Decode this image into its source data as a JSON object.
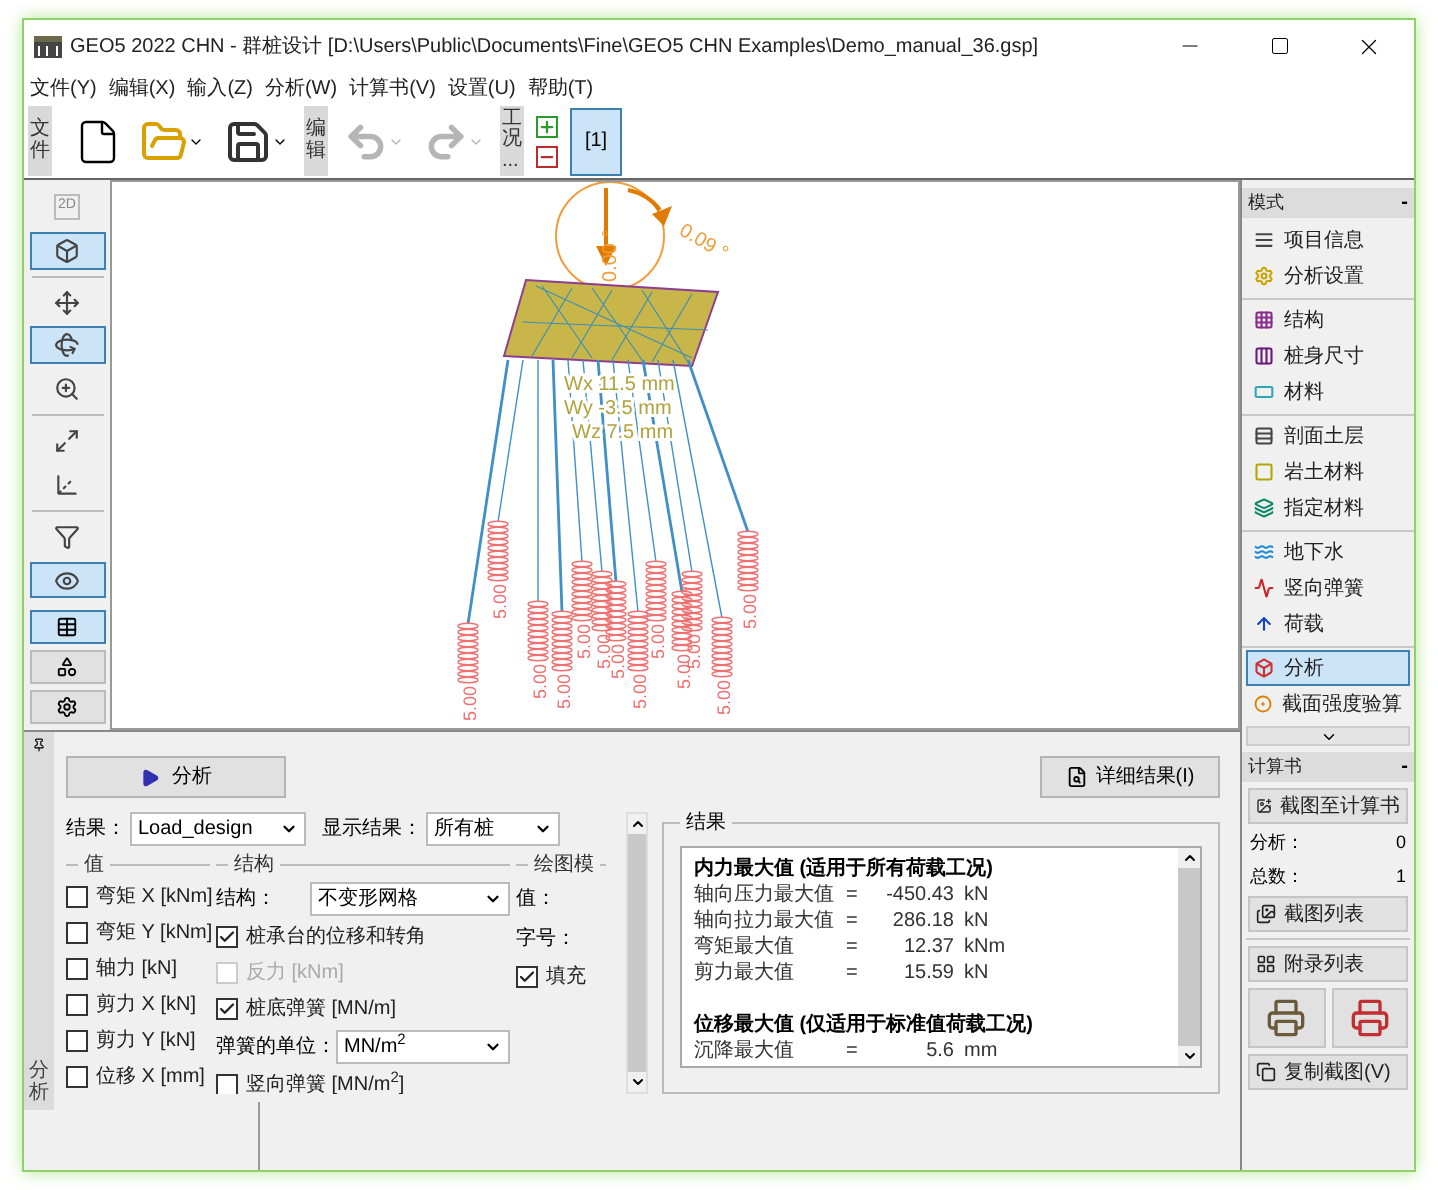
{
  "window": {
    "title": "GEO5 2022 CHN - 群桩设计 [D:\\Users\\Public\\Documents\\Fine\\GEO5 CHN Examples\\Demo_manual_36.gsp]"
  },
  "menu": [
    "文件(Y)",
    "编辑(X)",
    "输入(Z)",
    "分析(W)",
    "计算书(V)",
    "设置(U)",
    "帮助(T)"
  ],
  "toolbar": {
    "file_label": "文件",
    "edit_label": "编辑",
    "stage_label": "工况...",
    "undo": {
      "disabled": true
    },
    "redo": {
      "disabled": true
    },
    "stages": [
      {
        "label": "[1]",
        "selected": true
      }
    ]
  },
  "left_tools": [
    {
      "kind": "flat",
      "label": "2D",
      "selected": false
    },
    {
      "kind": "cube",
      "selected": true
    },
    {
      "kind": "pan",
      "selected": false
    },
    {
      "kind": "rotate",
      "selected": true
    },
    {
      "kind": "zoom",
      "selected": false
    },
    {
      "kind": "fit",
      "selected": false
    },
    {
      "kind": "axes",
      "selected": false
    },
    {
      "kind": "filter",
      "selected": false
    },
    {
      "kind": "eye",
      "selected": true
    }
  ],
  "bottom_tools": [
    {
      "kind": "table",
      "selected": true
    },
    {
      "kind": "shapes",
      "selected": false
    },
    {
      "kind": "gear",
      "selected": false
    }
  ],
  "viewport": {
    "angle_labels": [
      "0.09 °",
      "0.00 °"
    ],
    "displacements": [
      "Wx 11.5 mm",
      "Wy -3.5 mm",
      "Wz 7.5 mm"
    ],
    "spring_labels": [
      "5.00",
      "5.00",
      "5.00",
      "5.00",
      "5.00",
      "5.00",
      "5.00",
      "5.00",
      "5.00",
      "5.00",
      "5.00",
      "5.00",
      "5.00"
    ]
  },
  "analysis_panel": {
    "tab_label": "分析",
    "run_button": "分析",
    "detail_button": "详细结果(I)",
    "result_label": "结果：",
    "result_value": "Load_design",
    "show_label": "显示结果：",
    "show_value": "所有桩",
    "values_group": {
      "title": "值",
      "items": [
        {
          "label": "弯矩 X [kNm]",
          "checked": false
        },
        {
          "label": "弯矩 Y [kNm]",
          "checked": false
        },
        {
          "label": "轴力 [kN]",
          "checked": false
        },
        {
          "label": "剪力 X [kN]",
          "checked": false
        },
        {
          "label": "剪力 Y [kN]",
          "checked": false
        },
        {
          "label": "位移 X [mm]",
          "checked": false
        }
      ]
    },
    "structure_group": {
      "title": "结构",
      "structure_label": "结构：",
      "structure_value": "不变形网格",
      "options": [
        {
          "label": "桩承台的位移和转角",
          "checked": true,
          "disabled": false
        },
        {
          "label": "反力 [kNm]",
          "checked": false,
          "disabled": true
        },
        {
          "label": "桩底弹簧 [MN/m]",
          "checked": true,
          "disabled": false
        }
      ],
      "unit_label": "弹簧的单位：",
      "unit_value": "MN/m$^{2}$",
      "more_options": [
        {
          "label": "竖向弹簧 [MN/m$^{2}$]",
          "checked": false,
          "disabled": false
        }
      ]
    },
    "drawing_group": {
      "title": "绘图模",
      "value_label": "值：",
      "size_label": "字号：",
      "fill": {
        "label": "填充",
        "checked": true
      }
    },
    "results": {
      "title": "结果",
      "lines": [
        {
          "kind": "heading",
          "text": "内力最大值 (适用于所有荷载工况)"
        },
        {
          "kind": "row",
          "label": "轴向压力最大值",
          "sign": "=",
          "value": "-450.43",
          "unit": "kN"
        },
        {
          "kind": "row",
          "label": "轴向拉力最大值",
          "sign": "=",
          "value": "286.18",
          "unit": "kN"
        },
        {
          "kind": "row",
          "label": "弯矩最大值",
          "sign": "=",
          "value": "12.37",
          "unit": "kNm"
        },
        {
          "kind": "row",
          "label": "剪力最大值",
          "sign": "=",
          "value": "15.59",
          "unit": "kN"
        },
        {
          "kind": "heading",
          "text": "位移最大值 (仅适用于标准值荷载工况)"
        },
        {
          "kind": "row",
          "label": "沉降最大值",
          "sign": "=",
          "value": "5.6",
          "unit": "mm"
        }
      ]
    }
  },
  "right_panel": {
    "mode_title": "模式",
    "collapse_label": "-",
    "groups": [
      {
        "items": [
          {
            "kind": "info",
            "label": "项目信息",
            "selected": false
          },
          {
            "kind": "settings",
            "label": "分析设置",
            "selected": false
          }
        ]
      },
      {
        "items": [
          {
            "kind": "structure",
            "label": "结构",
            "selected": false
          },
          {
            "kind": "pile",
            "label": "桩身尺寸",
            "selected": false
          },
          {
            "kind": "material",
            "label": "材料",
            "selected": false
          }
        ]
      },
      {
        "items": [
          {
            "kind": "profile",
            "label": "剖面土层",
            "selected": false
          },
          {
            "kind": "soil",
            "label": "岩土材料",
            "selected": false
          },
          {
            "kind": "assign",
            "label": "指定材料",
            "selected": false
          }
        ]
      },
      {
        "items": [
          {
            "kind": "water",
            "label": "地下水",
            "selected": false
          },
          {
            "kind": "spring",
            "label": "竖向弹簧",
            "selected": false
          },
          {
            "kind": "load",
            "label": "荷载",
            "selected": false
          }
        ]
      },
      {
        "items": [
          {
            "kind": "analysis",
            "label": "分析",
            "selected": true
          },
          {
            "kind": "check",
            "label": "截面强度验算",
            "selected": false
          }
        ]
      }
    ],
    "report": {
      "title": "计算书",
      "collapse_label": "-",
      "add_button": "截图至计算书",
      "analysis_label": "分析：",
      "analysis_count": "0",
      "total_label": "总数：",
      "total_count": "1",
      "list_button": "截图列表",
      "appendix_button": "附录列表",
      "copy_button": "复制截图(V)"
    }
  }
}
